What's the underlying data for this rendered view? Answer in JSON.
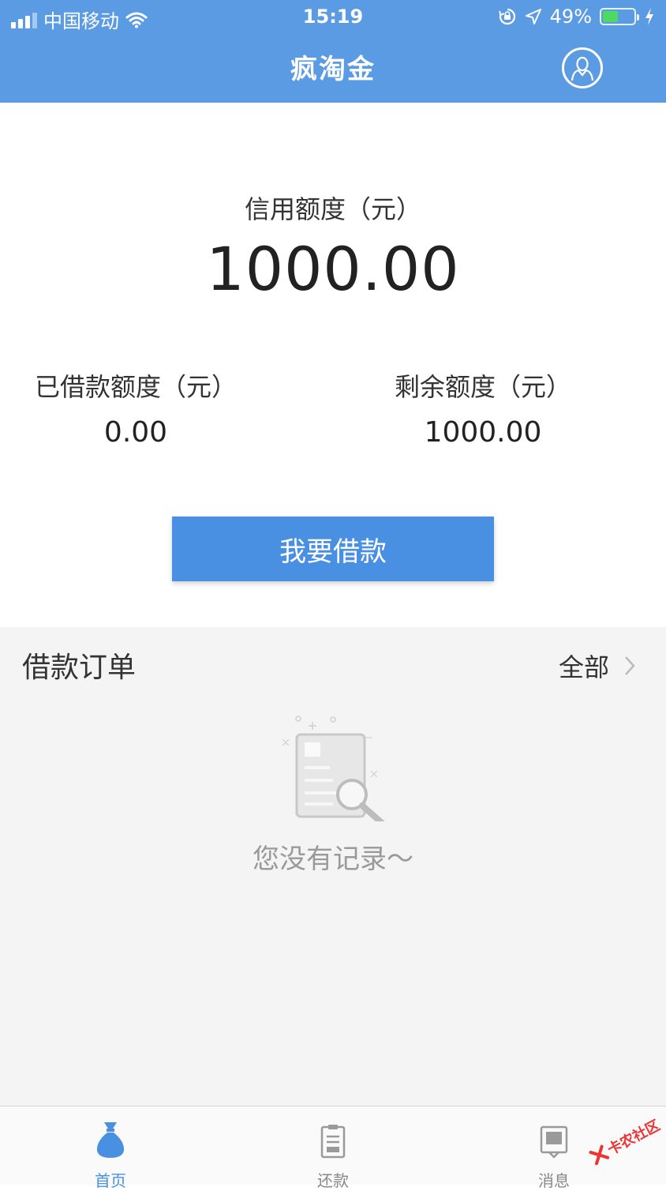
{
  "status_bar": {
    "carrier": "中国移动",
    "time": "15:19",
    "battery_percent": "49%",
    "battery_level": 0.49,
    "icons": [
      "signal-icon",
      "wifi-icon",
      "orientation-lock-icon",
      "location-icon",
      "battery-icon",
      "charging-icon"
    ]
  },
  "nav": {
    "title": "疯淘金",
    "profile_icon": "user-profile-icon"
  },
  "credit": {
    "label": "信用额度（元）",
    "amount": "1000.00"
  },
  "stats": {
    "borrowed_label": "已借款额度（元）",
    "borrowed_value": "0.00",
    "remaining_label": "剩余额度（元）",
    "remaining_value": "1000.00"
  },
  "actions": {
    "borrow_label": "我要借款"
  },
  "orders": {
    "title": "借款订单",
    "all_label": "全部",
    "empty_text": "您没有记录～",
    "empty_icon": "document-search-icon"
  },
  "tabbar": {
    "items": [
      {
        "label": "首页",
        "icon": "money-bag-icon",
        "active": true
      },
      {
        "label": "还款",
        "icon": "clipboard-icon",
        "active": false
      },
      {
        "label": "消息",
        "icon": "message-icon",
        "active": false
      }
    ]
  },
  "watermark": {
    "text": "卡农社区"
  },
  "colors": {
    "header": "#5b9be3",
    "primary_button": "#4a90e2",
    "tab_active": "#4a90e2",
    "section_bg": "#f4f4f4",
    "watermark": "#e33333"
  }
}
